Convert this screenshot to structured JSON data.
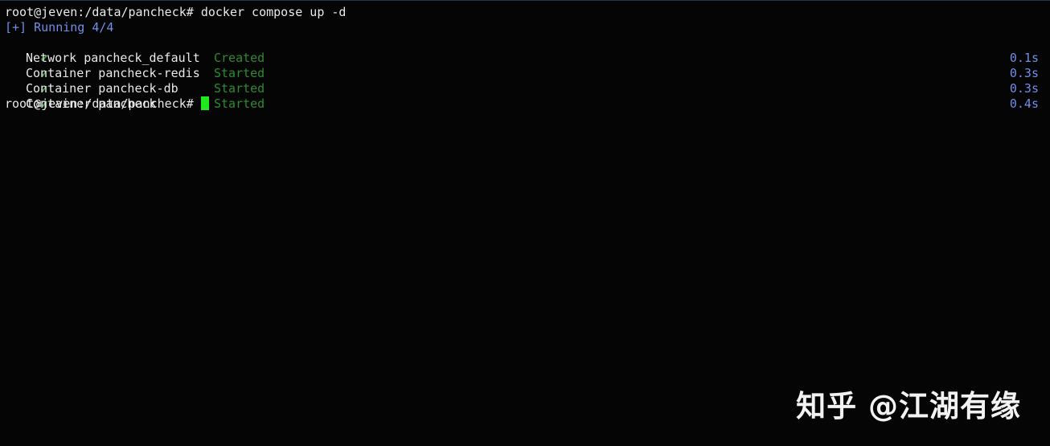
{
  "prompt": "root@jeven:/data/pancheck#",
  "command": "docker compose up -d",
  "running_line": "[+] Running 4/4",
  "check_glyph": "✔",
  "steps": [
    {
      "item": "Network pancheck_default",
      "status": "Created",
      "duration": "0.1s"
    },
    {
      "item": "Container pancheck-redis",
      "status": "Started",
      "duration": "0.3s"
    },
    {
      "item": "Container pancheck-db",
      "status": "Started",
      "duration": "0.3s"
    },
    {
      "item": "Container pancheck",
      "status": "Started",
      "duration": "0.4s"
    }
  ],
  "watermark": "知乎 @江湖有缘",
  "colors": {
    "background": "#050505",
    "foreground": "#e8e8e8",
    "info_blue": "#6f8fe8",
    "status_green": "#2e8b2e",
    "cursor_green": "#1fe81f"
  }
}
